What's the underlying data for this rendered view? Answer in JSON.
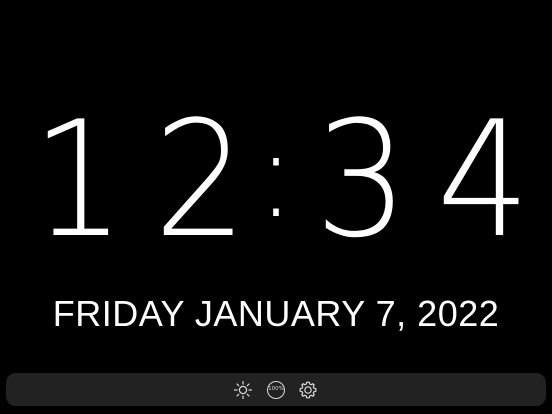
{
  "clock": {
    "digits": [
      "1",
      "2",
      "3",
      "4"
    ],
    "separator": ":"
  },
  "date": {
    "text": "FRIDAY JANUARY 7, 2022"
  },
  "toolbar": {
    "brightness_icon": "sun-icon",
    "zoom_label": "100%",
    "settings_icon": "gear-icon"
  },
  "colors": {
    "background": "#000000",
    "text": "#ffffff",
    "toolbar_bg": "#222222",
    "icon": "#d9d9d9"
  }
}
